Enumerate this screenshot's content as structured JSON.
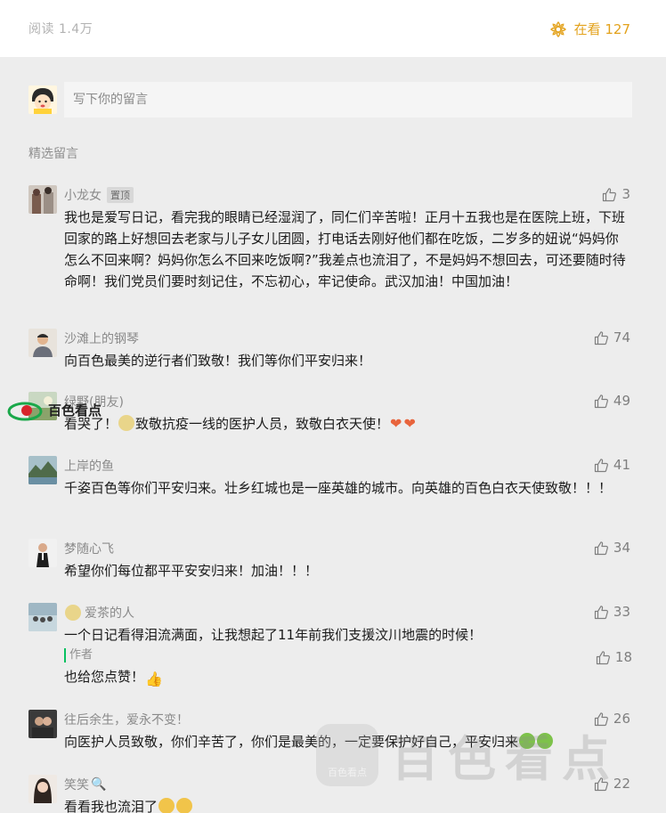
{
  "header": {
    "read_label": "阅读 1.4万",
    "looking_label": "在看 127",
    "accent_color": "#e3a21c",
    "looking_icon": "flower-icon"
  },
  "comment_box": {
    "placeholder": "写下你的留言"
  },
  "section_title": "精选留言",
  "comments": [
    {
      "nick": "小龙女",
      "badge": "置顶",
      "likes": "3",
      "text": "我也是爱写日记，看完我的眼睛已经湿润了，同仁们辛苦啦！正月十五我也是在医院上班，下班回家的路上好想回去老家与儿子女儿团圆，打电话去刚好他们都在吃饭，二岁多的妞说“妈妈你怎么不回来啊？妈妈你怎么不回来吃饭啊?”我差点也流泪了，不是妈妈不想回去，可还要随时待命啊！我们党员们要时刻记住，不忘初心，牢记使命。武汉加油！中国加油！"
    },
    {
      "nick": "沙滩上的钢琴",
      "likes": "74",
      "text": "向百色最美的逆行者们致敬！我们等你们平安归来！"
    },
    {
      "nick": "绿野(朋友)",
      "likes": "49",
      "text_a": "看哭了！",
      "text_b": "致敬抗疫一线的医护人员，致敬白衣天使！"
    },
    {
      "nick": "上岸的鱼",
      "likes": "41",
      "text": "千姿百色等你们平安归来。壮乡红城也是一座英雄的城市。向英雄的百色白衣天使致敬！！！"
    },
    {
      "nick": "梦随心飞",
      "likes": "34",
      "text": "希望你们每位都平平安安归来！加油！！！"
    },
    {
      "nick": "爱茶的人",
      "likes": "33",
      "text": "一个日记看得泪流满面，让我想起了11年前我们支援汶川地震的时候！",
      "reply": {
        "tag": "作者",
        "likes": "18",
        "text": "也给您点赞！"
      }
    },
    {
      "nick": "往后余生，爱永不变！",
      "likes": "26",
      "text": "向医护人员致敬，你们辛苦了，你们是最美的，一定要保护好自己，平安归来"
    },
    {
      "nick": "笑笑",
      "likes": "22",
      "text": "看看我也流泪了"
    }
  ],
  "watermarks": {
    "small": "百色看点",
    "large": "百色看点",
    "logo_caption": "百色看点"
  }
}
